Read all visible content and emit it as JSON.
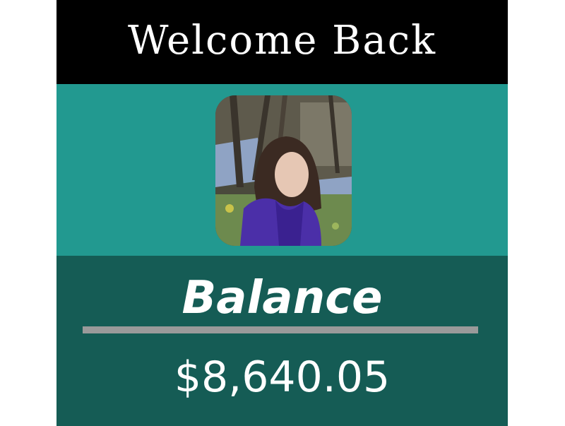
{
  "header": {
    "title": "Welcome Back"
  },
  "profile": {
    "avatar_icon": "user-photo"
  },
  "balance": {
    "label": "Balance",
    "amount": "$8,640.05"
  },
  "colors": {
    "header_bg": "#000000",
    "profile_bg": "#229990",
    "balance_bg": "#155c55",
    "divider": "#9a9a9a",
    "text": "#ffffff"
  }
}
